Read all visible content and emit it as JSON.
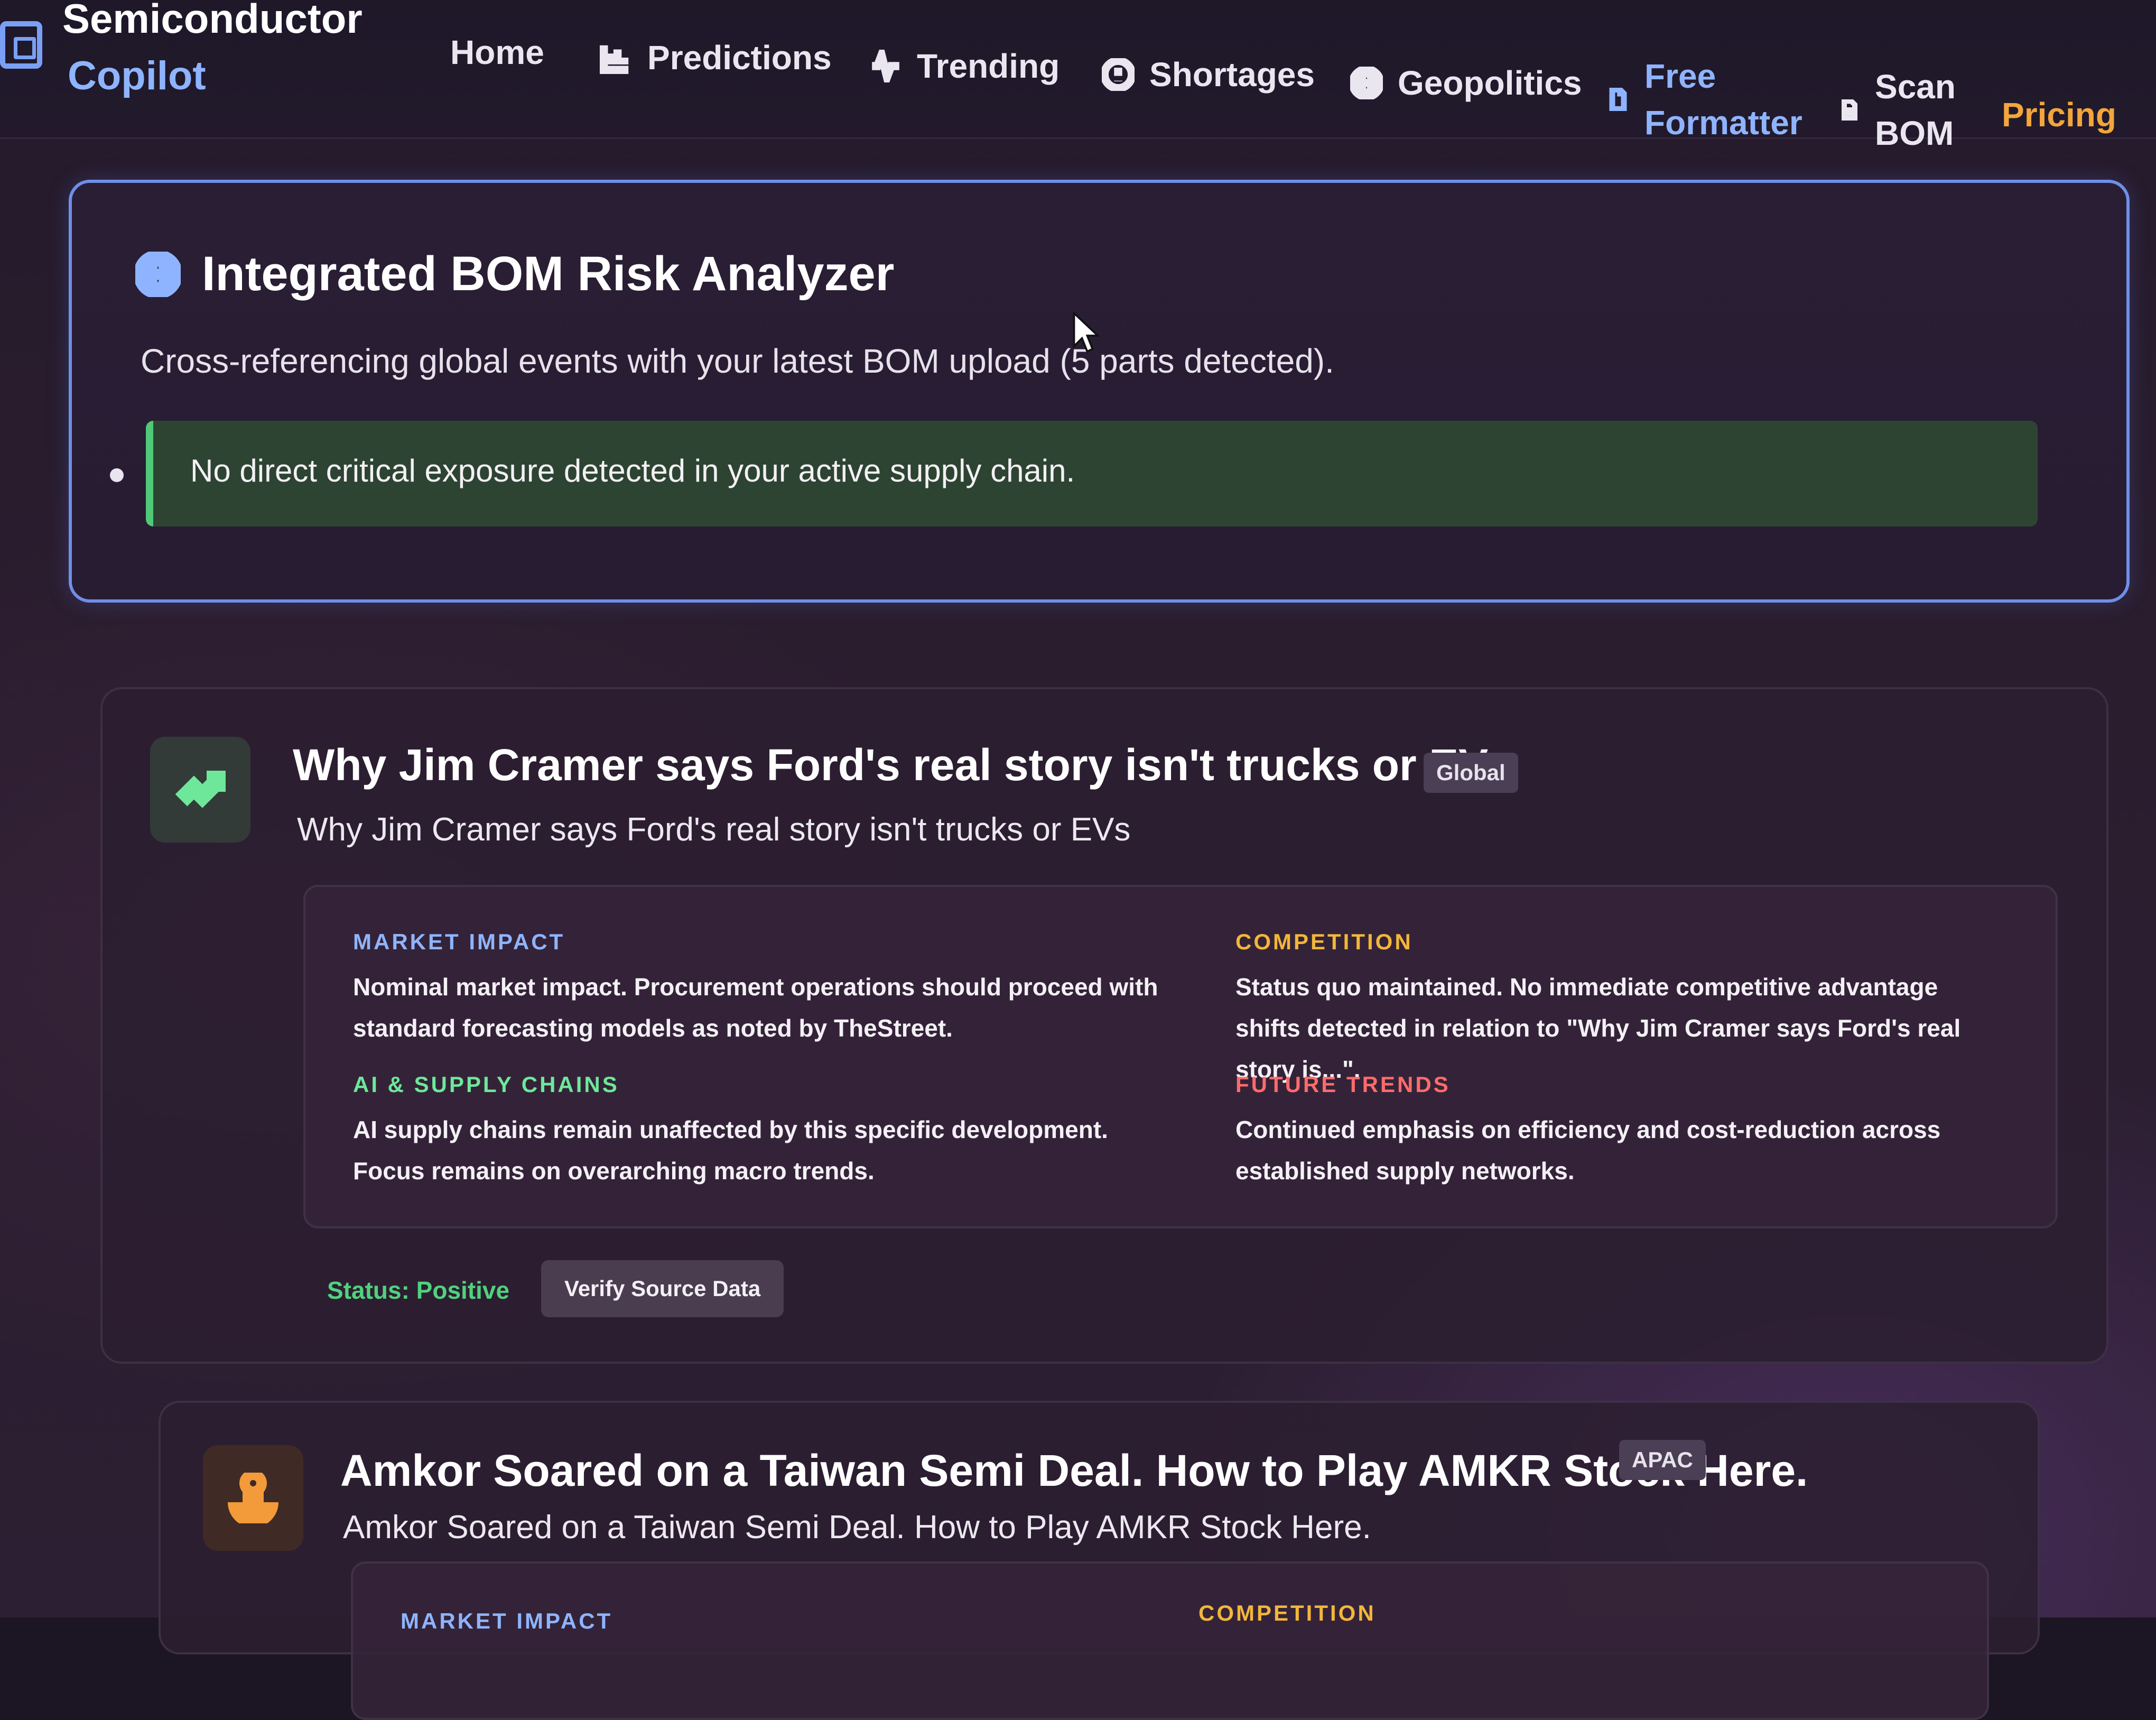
{
  "brand": {
    "line1": "Semiconductor",
    "line2": "Copilot"
  },
  "nav": {
    "home": "Home",
    "predictions": "Predictions",
    "trending": "Trending",
    "shortages": "Shortages",
    "geopolitics": "Geopolitics",
    "free_formatter_l1": "Free",
    "free_formatter_l2": "Formatter",
    "scan_bom_l1": "Scan",
    "scan_bom_l2": "BOM",
    "pricing": "Pricing"
  },
  "bom": {
    "title": "Integrated BOM Risk Analyzer",
    "subtitle": "Cross-referencing global events with your latest BOM upload (5 parts detected).",
    "alert": "No direct critical exposure detected in your active supply chain."
  },
  "news": [
    {
      "title": "Why Jim Cramer says Ford's real story isn't trucks or EVs",
      "region": "Global",
      "subtitle": "Why Jim Cramer says Ford's real story isn't trucks or EVs",
      "icon": "trending-up-icon",
      "market_impact_label": "MARKET IMPACT",
      "market_impact_text": "Nominal market impact. Procurement operations should proceed with standard forecasting models as noted by TheStreet.",
      "competition_label": "COMPETITION",
      "competition_text": "Status quo maintained. No immediate competitive advantage shifts detected in relation to \"Why Jim Cramer says Ford's real story is...\".",
      "ai_label": "AI & SUPPLY CHAINS",
      "ai_text": "AI supply chains remain unaffected by this specific development. Focus remains on overarching macro trends.",
      "future_label": "FUTURE TRENDS",
      "future_text": "Continued emphasis on efficiency and cost-reduction across established supply networks.",
      "status": "Status: Positive",
      "verify": "Verify Source Data"
    },
    {
      "title": "Amkor Soared on a Taiwan Semi Deal. How to Play AMKR Stock Here.",
      "region": "APAC",
      "subtitle": "Amkor Soared on a Taiwan Semi Deal. How to Play AMKR Stock Here.",
      "icon": "anchor-icon",
      "market_impact_label": "MARKET IMPACT",
      "competition_label": "COMPETITION"
    }
  ],
  "colors": {
    "accent_blue": "#8fb4ff",
    "positive_green": "#4fd27e",
    "pricing_orange": "#f3a63a",
    "competition_yellow": "#f2b63a",
    "future_red": "#ff6b6b"
  }
}
